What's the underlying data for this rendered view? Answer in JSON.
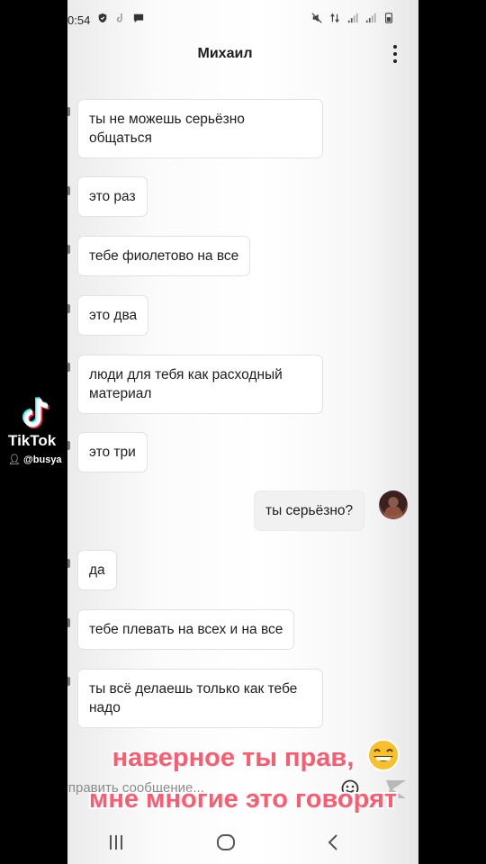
{
  "status_bar": {
    "time": "0:54"
  },
  "header": {
    "title": "Михаил"
  },
  "messages": [
    {
      "text": "ты не можешь серьёзно общаться",
      "direction": "incoming"
    },
    {
      "text": "это раз",
      "direction": "incoming"
    },
    {
      "text": "тебе фиолетово на все",
      "direction": "incoming"
    },
    {
      "text": "это два",
      "direction": "incoming"
    },
    {
      "text": "люди для тебя как расходный материал",
      "direction": "incoming"
    },
    {
      "text": "это три",
      "direction": "incoming"
    },
    {
      "text": "ты серьёзно?",
      "direction": "outgoing"
    },
    {
      "text": "да",
      "direction": "incoming"
    },
    {
      "text": "тебе плевать на всех и на все",
      "direction": "incoming"
    },
    {
      "text": "ты всё делаешь только как тебе надо",
      "direction": "incoming"
    }
  ],
  "input": {
    "placeholder": "тправить сообщение..."
  },
  "overlay": {
    "brand": "TikTok",
    "username": "@busya",
    "caption_line1": "наверное ты прав,",
    "caption_line2": "мне многие это говорят"
  },
  "colors": {
    "caption_text": "#ff5a6e",
    "caption_outline": "#ffffff",
    "bubble": "#ffffff",
    "outgoing_bubble": "#f1f1f1"
  }
}
